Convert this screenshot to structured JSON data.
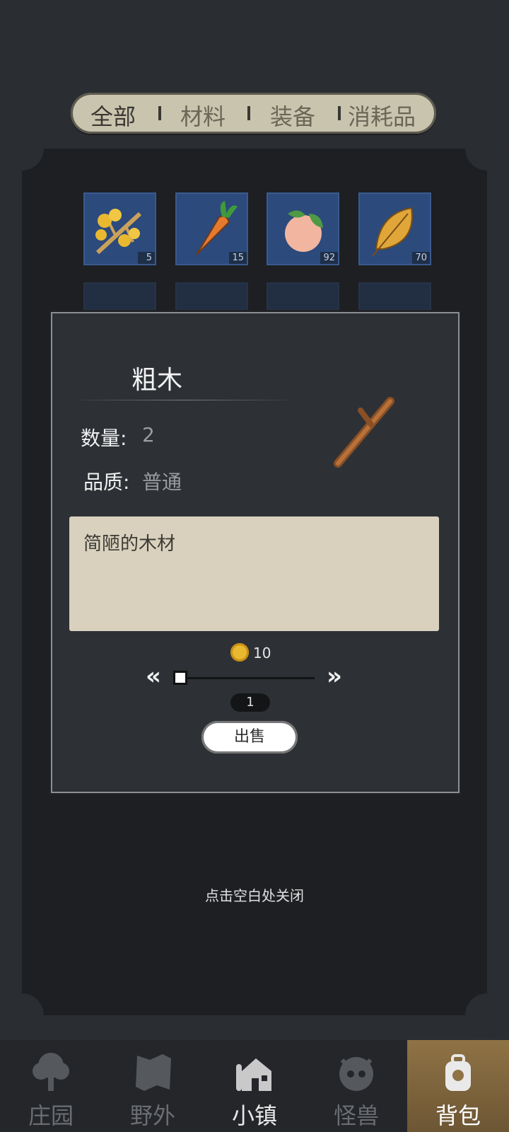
{
  "tabs": [
    {
      "label": "全部",
      "active": true
    },
    {
      "label": "材料",
      "active": false
    },
    {
      "label": "装备",
      "active": false
    },
    {
      "label": "消耗品",
      "active": false
    }
  ],
  "inventory": {
    "row1": [
      {
        "icon": "yellow-berry-branch-icon",
        "count": "5"
      },
      {
        "icon": "carrot-icon",
        "count": "15"
      },
      {
        "icon": "peach-icon",
        "count": "92"
      },
      {
        "icon": "leaf-icon",
        "count": "70"
      }
    ]
  },
  "dialog": {
    "name": "粗木",
    "quantity_label": "数量",
    "quantity_value": "2",
    "quality_label": "品质",
    "quality_value": "普通",
    "description": "简陋的木材",
    "price": "10",
    "sell_qty": "1",
    "sell_label": "出售",
    "icon": "wood-stick-icon"
  },
  "close_hint": "点击空白处关闭",
  "nav": [
    {
      "label": "庄园",
      "icon": "manor-icon"
    },
    {
      "label": "野外",
      "icon": "map-icon"
    },
    {
      "label": "小镇",
      "icon": "town-icon"
    },
    {
      "label": "怪兽",
      "icon": "monster-icon"
    },
    {
      "label": "背包",
      "icon": "backpack-icon"
    }
  ],
  "colors": {
    "accent_nav": "#8f7345",
    "slot_bg": "#2c4a7c",
    "coin": "#e8b830"
  }
}
